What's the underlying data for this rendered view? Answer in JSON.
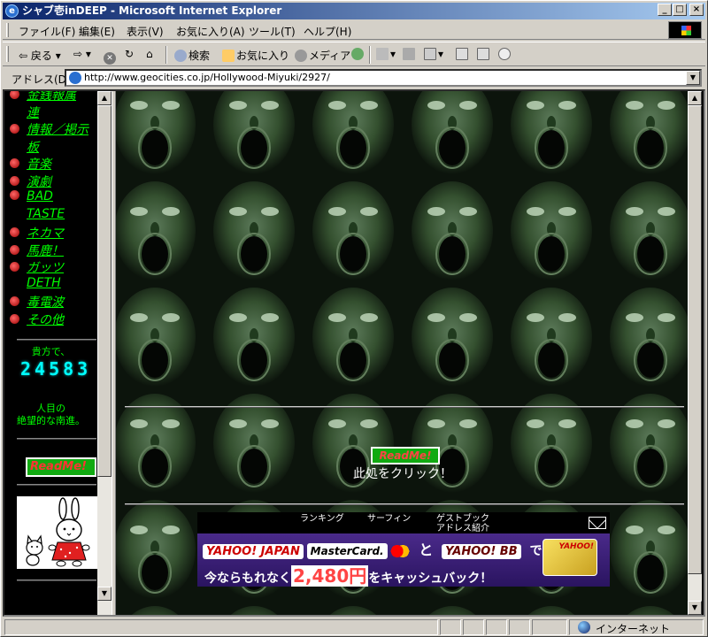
{
  "window": {
    "title": "シャブ壱inDEEP - Microsoft Internet Explorer",
    "min_glyph": "_",
    "max_glyph": "□",
    "close_glyph": "×",
    "icon_glyph": "e",
    "icon": "ie-icon"
  },
  "menu": {
    "items": [
      "ファイル(F)",
      "編集(E)",
      "表示(V)",
      "お気に入り(A)",
      "ツール(T)",
      "ヘルプ(H)"
    ]
  },
  "toolbar": {
    "back": "戻る",
    "forward_glyph": "⇨",
    "stop_glyph": "✕",
    "refresh_glyph": "↻",
    "home_glyph": "⌂",
    "search": "検索",
    "favorites": "お気に入り",
    "media": "メディア"
  },
  "address": {
    "label": "アドレス(D)",
    "url": "http://www.geocities.co.jp/Hollywood-Miyuki/2927/",
    "drop_glyph": "▼"
  },
  "sidebar": {
    "nav": [
      {
        "lines": [
          "金銭報属",
          "連"
        ]
      },
      {
        "lines": [
          "情報／掲示",
          "板"
        ]
      },
      {
        "lines": [
          "音楽"
        ]
      },
      {
        "lines": [
          "演劇"
        ]
      },
      {
        "lines": [
          "BAD",
          "TASTE"
        ]
      },
      {
        "lines": [
          "ネカマ"
        ]
      },
      {
        "lines": [
          "馬鹿！"
        ]
      },
      {
        "lines": [
          "ガッツ",
          "DETH"
        ]
      },
      {
        "lines": [
          "毒電波"
        ]
      },
      {
        "lines": [
          "その他"
        ]
      }
    ],
    "visitor_text": "貴方で、",
    "counter": "24583",
    "tagline_1": "人目の",
    "tagline_2": "絶望的な南進。",
    "readme": "ReadMe!"
  },
  "main": {
    "readme": "ReadMe!",
    "click_text": "此処をクリック！",
    "geo_links": {
      "ranking": "ランキング",
      "surfing": "サーフィン",
      "guestbook": "ゲストブック",
      "address_intro": "アドレス紹介"
    },
    "banner": {
      "yahoo_japan": "YAHOO! JAPAN",
      "mastercard": "MasterCard.",
      "to": "と",
      "yahoo_bb": "YAHOO! BB",
      "de": "で",
      "line2_pre": "今ならもれなく",
      "price": "2,480円",
      "line2_post": "をキャッシュバック！",
      "card_label": "YAHOO!"
    }
  },
  "status": {
    "zone": "インターネット"
  },
  "colors": {
    "title_gradient_start": "#0a246a",
    "title_gradient_end": "#a6caf0",
    "nav_text": "#00ff00",
    "counter": "#00ffff",
    "banner_bg": "#3a1e78"
  }
}
